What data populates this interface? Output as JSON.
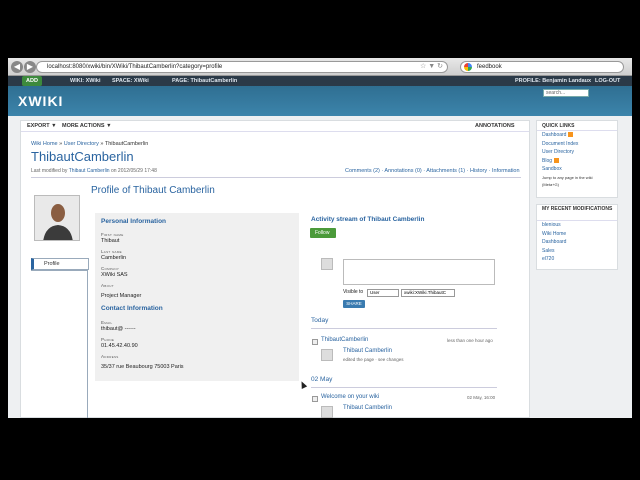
{
  "browser": {
    "url": "localhost:8080/xwiki/bin/XWiki/ThibautCamberlin?category=profile",
    "search_value": "feedbook"
  },
  "topmenu": {
    "add": "ADD",
    "wiki": "WIKI: XWiki",
    "space": "SPACE: XWiki",
    "page": "PAGE: ThibautCamberlin",
    "profile": "PROFILE: Benjamin Landaux",
    "logout": "LOG-OUT"
  },
  "header": {
    "logo": "XWIKI",
    "search_placeholder": "search..."
  },
  "actions": {
    "export": "EXPORT ▼",
    "more": "MORE ACTIONS ▼",
    "annotations": "ANNOTATIONS"
  },
  "breadcrumb": {
    "home": "Wiki Home",
    "dir": "User Directory",
    "current": "ThibautCamberlin"
  },
  "page": {
    "title": "ThibautCamberlin",
    "modified_prefix": "Last modified by",
    "modified_user": "Thibaut Camberlin",
    "modified_date": "on 2012/05/29 17:48",
    "tabs": "Comments (2) · Annotations (0) · Attachments (1) · History · Information"
  },
  "sidebar": {
    "profile_tab": "Profile"
  },
  "profile": {
    "heading": "Profile of Thibaut Camberlin",
    "personal_heading": "Personal Information",
    "first_name_label": "First name",
    "first_name": "Thibaut",
    "last_name_label": "Last name",
    "last_name": "Camberlin",
    "company_label": "Company",
    "company": "XWiki SAS",
    "about_label": "About",
    "about": "Project Manager",
    "contact_heading": "Contact Information",
    "email_label": "Email",
    "email": "thibaut@ ------",
    "phone_label": "Phone",
    "phone": "01.45.42.40.90",
    "address_label": "Address",
    "address": "35/37 rue Beaubourg 75003 Paris"
  },
  "activity": {
    "heading": "Activity stream of Thibaut Camberlin",
    "follow": "Follow",
    "visible_label": "Visible to",
    "visible_select": "User",
    "visible_input": "xwiki:XWiki.ThibautC",
    "share": "SHARE",
    "days": [
      {
        "label": "Today",
        "event_title": "ThibautCamberlin",
        "event_time": "less than one hour ago",
        "user": "Thibaut Camberlin",
        "desc": "edited the page · see changes"
      },
      {
        "label": "02 May",
        "event_title": "Welcome on your wiki",
        "event_time": "02 May, 16:00",
        "user": "Thibaut Camberlin",
        "desc": ""
      }
    ]
  },
  "quicklinks": {
    "heading": "QUICK LINKS",
    "items": [
      "Dashboard",
      "Document Index",
      "User Directory",
      "Blog",
      "Sandbox"
    ],
    "jump": "Jump to any page in the wiki",
    "jump_hint": "(Meta+G)"
  },
  "recent": {
    "heading": "MY RECENT MODIFICATIONS",
    "items": [
      "blenious",
      "Wiki Home",
      "Dashboard",
      "Sales",
      "el720"
    ]
  }
}
